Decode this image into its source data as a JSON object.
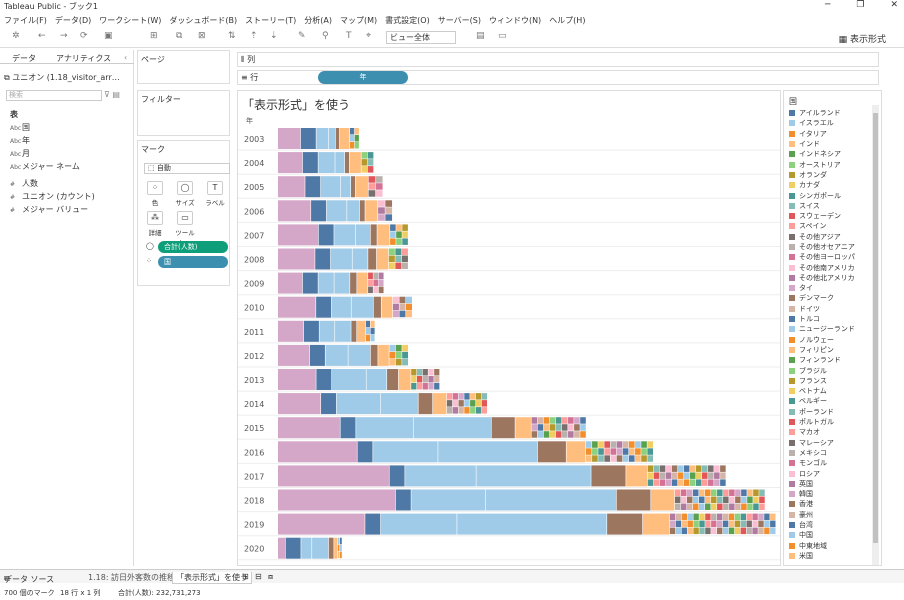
{
  "window": {
    "title": "Tableau Public - ブック1"
  },
  "menu": [
    "ファイル(F)",
    "データ(D)",
    "ワークシート(W)",
    "ダッシュボード(B)",
    "ストーリー(T)",
    "分析(A)",
    "マップ(M)",
    "書式設定(O)",
    "サーバー(S)",
    "ウィンドウ(N)",
    "ヘルプ(H)"
  ],
  "toolbar": {
    "view_select": "ビュー全体",
    "show_me": "表示形式"
  },
  "left": {
    "tab_data": "データ",
    "tab_analytics": "アナリティクス",
    "datasource": "ユニオン (1.18_visitor_arr…",
    "search_placeholder": "検索",
    "section_table": "表",
    "fields": [
      {
        "icon": "Abc",
        "label": "国"
      },
      {
        "icon": "Abc",
        "label": "年"
      },
      {
        "icon": "Abc",
        "label": "月"
      },
      {
        "icon": "Abc",
        "label": "メジャー ネーム"
      },
      {
        "icon": "#",
        "label": "人数"
      },
      {
        "icon": "#",
        "label": "ユニオン (カウント)"
      },
      {
        "icon": "#",
        "label": "メジャー バリュー"
      }
    ]
  },
  "cards": {
    "pages": "ページ",
    "filters": "フィルター",
    "marks": "マーク",
    "mark_type": "自動",
    "btn_color": "色",
    "btn_size": "サイズ",
    "btn_label": "ラベル",
    "btn_detail": "詳細",
    "btn_tooltip": "ツールヒ…",
    "pill_sum": "合計(人数)",
    "pill_country": "国"
  },
  "shelves": {
    "columns": "列",
    "rows": "行",
    "rows_pill": "年"
  },
  "viz": {
    "title": "「表示形式」を使う",
    "row_header": "年"
  },
  "legend": {
    "title": "国",
    "items": [
      {
        "label": "アイルランド",
        "color": "#4e79a7"
      },
      {
        "label": "イスラエル",
        "color": "#a0cbe8"
      },
      {
        "label": "イタリア",
        "color": "#f28e2b"
      },
      {
        "label": "インド",
        "color": "#ffbe7d"
      },
      {
        "label": "インドネシア",
        "color": "#59a14f"
      },
      {
        "label": "オーストリア",
        "color": "#8cd17d"
      },
      {
        "label": "オランダ",
        "color": "#b6992d"
      },
      {
        "label": "カナダ",
        "color": "#f1ce63"
      },
      {
        "label": "シンガポール",
        "color": "#499894"
      },
      {
        "label": "スイス",
        "color": "#86bcb6"
      },
      {
        "label": "スウェーデン",
        "color": "#e15759"
      },
      {
        "label": "スペイン",
        "color": "#ff9d9a"
      },
      {
        "label": "その他アジア",
        "color": "#79706e"
      },
      {
        "label": "その他オセアニア",
        "color": "#bab0ac"
      },
      {
        "label": "その他ヨーロッパ",
        "color": "#d37295"
      },
      {
        "label": "その他南アメリカ",
        "color": "#fabfd2"
      },
      {
        "label": "その他北アメリカ",
        "color": "#b07aa1"
      },
      {
        "label": "タイ",
        "color": "#d4a6c8"
      },
      {
        "label": "デンマーク",
        "color": "#9d7660"
      },
      {
        "label": "ドイツ",
        "color": "#d7b5a6"
      },
      {
        "label": "トルコ",
        "color": "#4e79a7"
      },
      {
        "label": "ニュージーランド",
        "color": "#a0cbe8"
      },
      {
        "label": "ノルウェー",
        "color": "#f28e2b"
      },
      {
        "label": "フィリピン",
        "color": "#ffbe7d"
      },
      {
        "label": "フィンランド",
        "color": "#59a14f"
      },
      {
        "label": "ブラジル",
        "color": "#8cd17d"
      },
      {
        "label": "フランス",
        "color": "#b6992d"
      },
      {
        "label": "ベトナム",
        "color": "#f1ce63"
      },
      {
        "label": "ベルギー",
        "color": "#499894"
      },
      {
        "label": "ポーランド",
        "color": "#86bcb6"
      },
      {
        "label": "ポルトガル",
        "color": "#e15759"
      },
      {
        "label": "マカオ",
        "color": "#ff9d9a"
      },
      {
        "label": "マレーシア",
        "color": "#79706e"
      },
      {
        "label": "メキシコ",
        "color": "#bab0ac"
      },
      {
        "label": "モンゴル",
        "color": "#d37295"
      },
      {
        "label": "ロシア",
        "color": "#fabfd2"
      },
      {
        "label": "英国",
        "color": "#b07aa1"
      },
      {
        "label": "韓国",
        "color": "#d4a6c8"
      },
      {
        "label": "香港",
        "color": "#9d7660"
      },
      {
        "label": "豪州",
        "color": "#d7b5a6"
      },
      {
        "label": "台湾",
        "color": "#4e79a7"
      },
      {
        "label": "中国",
        "color": "#a0cbe8"
      },
      {
        "label": "中東地域",
        "color": "#f28e2b"
      },
      {
        "label": "米国",
        "color": "#ffbe7d"
      }
    ]
  },
  "bottom": {
    "datasource_tab": "データ ソース",
    "sheet1": "1.18: 訪日外客数の推移",
    "sheet2": "「表示形式」を使う"
  },
  "status": {
    "marks": "700 個のマーク",
    "rowscols": "18 行 x 1 列",
    "total": "合計(人数): 232,731,273"
  },
  "chart_data": {
    "type": "bar",
    "stacked": true,
    "orientation": "horizontal",
    "categories": [
      "2003",
      "2004",
      "2005",
      "2006",
      "2007",
      "2008",
      "2009",
      "2010",
      "2011",
      "2012",
      "2013",
      "2014",
      "2015",
      "2016",
      "2017",
      "2018",
      "2019",
      "2020"
    ],
    "totals": [
      5211725,
      6137905,
      6727926,
      7334077,
      8346969,
      8350835,
      6789658,
      8611175,
      6218752,
      8358105,
      10363904,
      13413467,
      19737409,
      24039700,
      28691073,
      31191856,
      31882049,
      4115828
    ],
    "segments": {
      "names": [
        "タイ",
        "韓国",
        "台湾",
        "中国",
        "香港",
        "米国",
        "その他"
      ],
      "colors": [
        "#d4a6c8",
        "#4e79a7",
        "#a0cbe8",
        "#a0cbe8",
        "#9d7660",
        "#ffbe7d",
        "#b6992d"
      ],
      "values": [
        [
          1459333,
          1000000,
          785379,
          448782,
          260214,
          655821,
          602196
        ],
        [
          1588472,
          1000000,
          1080590,
          616009,
          300246,
          760000,
          792588
        ],
        [
          1747171,
          1000000,
          1274612,
          652820,
          298810,
          822033,
          932480
        ],
        [
          2117325,
          1000000,
          1309121,
          811675,
          352265,
          816727,
          926964
        ],
        [
          2600694,
          1000000,
          1385255,
          942439,
          432042,
          815882,
          1170657
        ],
        [
          2382397,
          1000000,
          1390228,
          1000416,
          550190,
          768345,
          1259259
        ],
        [
          1586772,
          1000000,
          1024292,
          1006085,
          449568,
          699919,
          1023022
        ],
        [
          2439816,
          1000000,
          1268278,
          1412875,
          508691,
          727234,
          1254281
        ],
        [
          1658073,
          1000000,
          993974,
          1043246,
          364865,
          565887,
          592707
        ],
        [
          2042775,
          1000000,
          1465753,
          1425100,
          481665,
          716709,
          1225103
        ],
        [
          2456165,
          1000000,
          2210821,
          1314437,
          745881,
          799280,
          1837320
        ],
        [
          2755313,
          1000000,
          2829821,
          2409158,
          925975,
          891668,
          2601532
        ],
        [
          4002095,
          1000000,
          3677075,
          4993689,
          1524292,
          1033258,
          3507000
        ],
        [
          5090302,
          1000000,
          4167512,
          6373564,
          1839193,
          1242719,
          4326410
        ],
        [
          7140438,
          1000000,
          4564053,
          7355818,
          2231568,
          1374964,
          5024232
        ],
        [
          7538952,
          1000000,
          4757258,
          8380034,
          2207804,
          1526407,
          5781401
        ],
        [
          5584597,
          1000000,
          4890602,
          9594394,
          2290792,
          1723861,
          6797803
        ],
        [
          487000,
          1000000,
          694500,
          1069000,
          346000,
          219000,
          300328
        ]
      ]
    },
    "xlabel": "",
    "ylabel": "年"
  }
}
